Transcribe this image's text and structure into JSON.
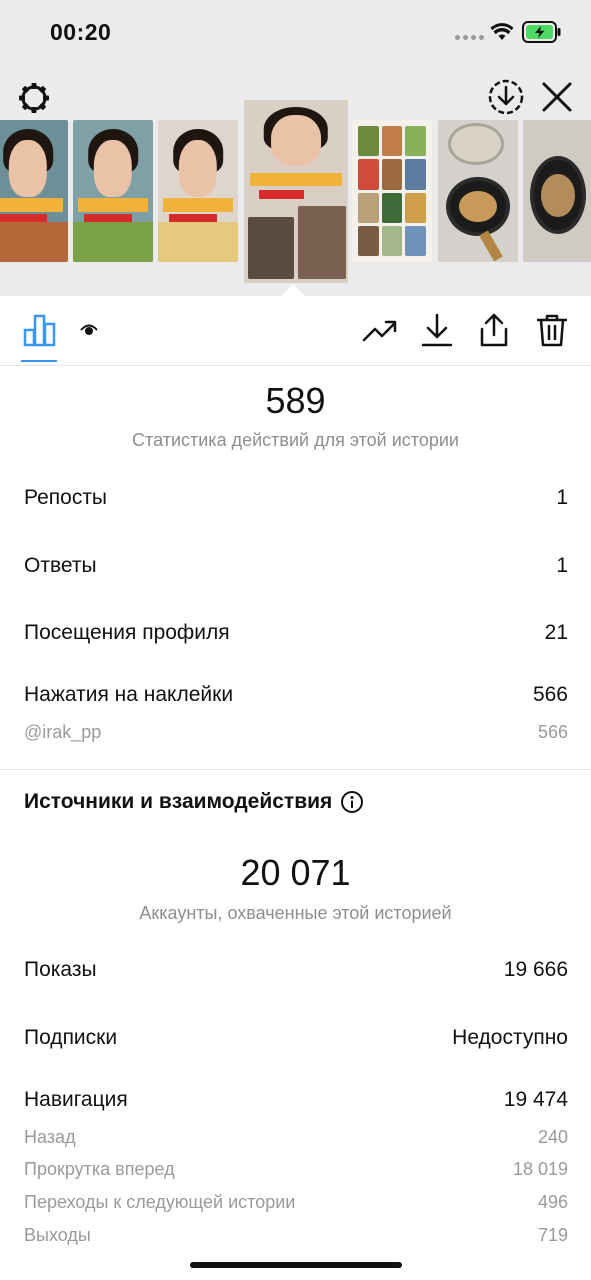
{
  "status_bar": {
    "time": "00:20"
  },
  "story_overview": {
    "total_actions": "589",
    "total_actions_caption": "Статистика действий для этой истории",
    "rows": [
      {
        "label": "Репосты",
        "value": "1"
      },
      {
        "label": "Ответы",
        "value": "1"
      },
      {
        "label": "Посещения профиля",
        "value": "21"
      },
      {
        "label": "Нажатия на наклейки",
        "value": "566"
      }
    ],
    "sticker_sub": {
      "label": "@irak_pp",
      "value": "566"
    }
  },
  "discovery": {
    "title": "Источники и взаимодействия",
    "reach": "20 071",
    "reach_caption": "Аккаунты, охваченные этой историей",
    "rows": [
      {
        "label": "Показы",
        "value": "19 666"
      },
      {
        "label": "Подписки",
        "value": "Недоступно"
      },
      {
        "label": "Навигация",
        "value": "19 474"
      }
    ],
    "navigation_sub": [
      {
        "label": "Назад",
        "value": "240"
      },
      {
        "label": "Прокрутка вперед",
        "value": "18 019"
      },
      {
        "label": "Переходы к следующей истории",
        "value": "496"
      },
      {
        "label": "Выходы",
        "value": "719"
      }
    ]
  },
  "icons": {
    "settings": "gear-icon",
    "download_circle": "download-circle-icon",
    "close": "close-icon",
    "insights": "bar-chart-icon",
    "viewers": "eye-icon",
    "promote": "trending-up-icon",
    "download": "download-icon",
    "share": "share-icon",
    "delete": "trash-icon",
    "info": "info-icon"
  },
  "colors": {
    "accent": "#3897f0",
    "muted_text": "#8e8e8e",
    "header_bg": "#ebebeb"
  }
}
